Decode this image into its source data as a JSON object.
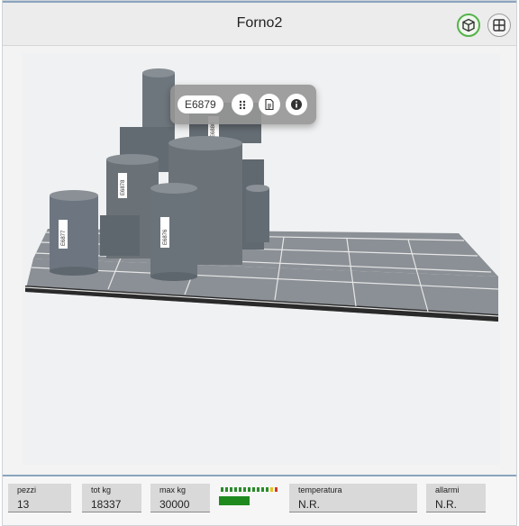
{
  "header": {
    "title": "Forno2",
    "view_3d_icon": "cube-icon",
    "view_grid_icon": "grid-icon"
  },
  "popup": {
    "code": "E6879",
    "buttons": [
      "drag-icon",
      "document-icon",
      "info-icon"
    ]
  },
  "scene_labels": {
    "left_cyl": "E6877",
    "mid_cyl": "E6878",
    "back_box": "E6880",
    "front_cyl": "E6876"
  },
  "footer": {
    "pezzi": {
      "label": "pezzi",
      "value": "13"
    },
    "tot_kg": {
      "label": "tot kg",
      "value": "18337"
    },
    "max_kg": {
      "label": "max kg",
      "value": "30000"
    },
    "load_fraction": 0.61,
    "temperatura": {
      "label": "temperatura",
      "value": "N.R."
    },
    "allarmi": {
      "label": "allarmi",
      "value": "N.R."
    }
  },
  "colors": {
    "accent": "#55b24a",
    "load_bar": "#1e8a1e",
    "piece": "#6e767d"
  }
}
